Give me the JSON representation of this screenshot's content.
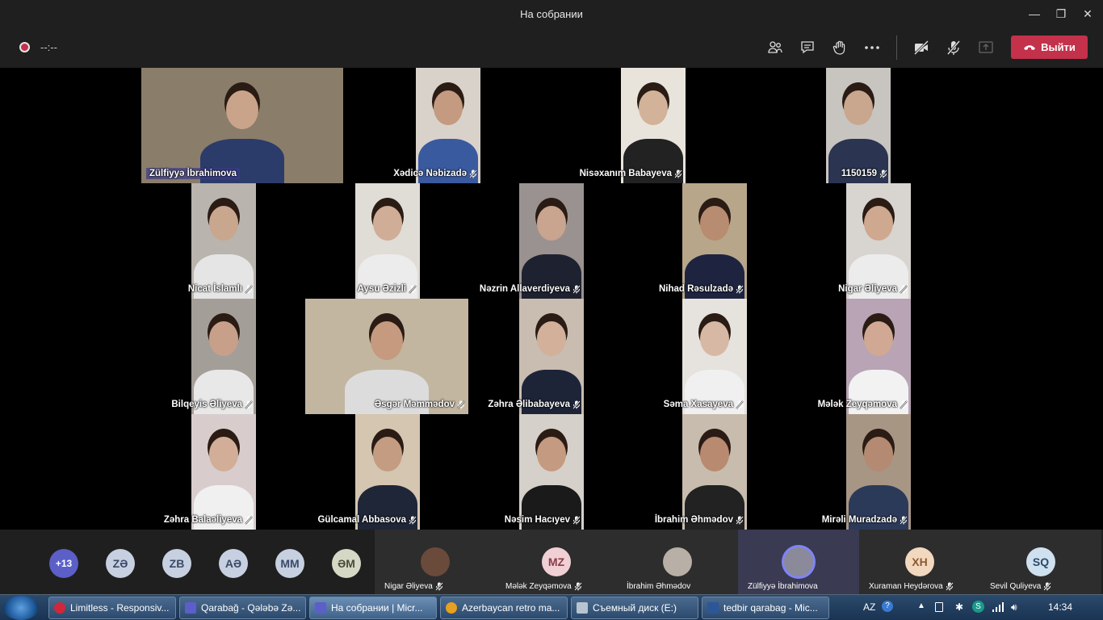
{
  "window": {
    "title": "На собрании"
  },
  "toolbar": {
    "timer": "--:--",
    "leave_label": "Выйти"
  },
  "tiles": [
    {
      "name": "Zülfiyyə İbrahimova",
      "label_style": "highlight",
      "skin": "#c9a48a",
      "bg": "#8a7d6a",
      "shirt": "#2b3b6a",
      "muted": false
    },
    {
      "name": "Xədicə Nəbizadə",
      "skin": "#c49a80",
      "bg": "#d9d2ca",
      "shirt": "#3a5aa0",
      "muted": true
    },
    {
      "name": "Nisəxanım Babayeva",
      "skin": "#d3b29a",
      "bg": "#e8e4dc",
      "shirt": "#222",
      "muted": true
    },
    {
      "name": "1150159",
      "skin": "#c9a68e",
      "bg": "#c8c4c0",
      "shirt": "#2b3450",
      "muted": true
    },
    {
      "name": "Nicat İslamlı",
      "skin": "#c9a68e",
      "bg": "#b9b4ad",
      "shirt": "#e5e5e5",
      "muted": true
    },
    {
      "name": "Aysu Əzizli",
      "skin": "#d0ad96",
      "bg": "#e0dcd6",
      "shirt": "#ececec",
      "muted": true
    },
    {
      "name": "Nəzrin Allaverdiyeva",
      "skin": "#c9a48e",
      "bg": "#9a9290",
      "shirt": "#1e2230",
      "muted": true
    },
    {
      "name": "Nihad Rəsulzadə",
      "skin": "#b88c70",
      "bg": "#b7a68a",
      "shirt": "#1e2440",
      "muted": true
    },
    {
      "name": "Nigar Əliyeva",
      "skin": "#cfa890",
      "bg": "#d8d4d0",
      "shirt": "#ececec",
      "muted": true
    },
    {
      "name": "Bilqeyis Əliyeva",
      "skin": "#c8a08a",
      "bg": "#a49e98",
      "shirt": "#e8e8e8",
      "muted": true
    },
    {
      "name": "Əsgər Məmmədov",
      "skin": "#c59a7e",
      "bg": "#c2b6a0",
      "shirt": "#dcdcdc",
      "muted": true
    },
    {
      "name": "Zəhra Əlibabayeva",
      "skin": "#d3b09a",
      "bg": "#c9bcb0",
      "shirt": "#1e2438",
      "muted": true
    },
    {
      "name": "Səma Xasayeva",
      "skin": "#d6b8a4",
      "bg": "#e6e2de",
      "shirt": "#f0f0f0",
      "muted": true
    },
    {
      "name": "Mələk Zeyqəmova",
      "skin": "#d0a894",
      "bg": "#b8a4b4",
      "shirt": "#f2f2f2",
      "muted": true
    },
    {
      "name": "Zəhra Balaəliyeva",
      "skin": "#d2ae98",
      "bg": "#d8cccc",
      "shirt": "#f0f0f0",
      "muted": true
    },
    {
      "name": "Gülcamal Abbasova",
      "skin": "#c49c82",
      "bg": "#d4c6b0",
      "shirt": "#1f2638",
      "muted": true
    },
    {
      "name": "Nəsim Hacıyev",
      "skin": "#c49a80",
      "bg": "#d6d0ca",
      "shirt": "#1a1a1a",
      "muted": true
    },
    {
      "name": "İbrahim Əhmədov",
      "skin": "#b88a70",
      "bg": "#c8bcae",
      "shirt": "#222",
      "muted": true
    },
    {
      "name": "Mirəli Muradzadə",
      "skin": "#b48a72",
      "bg": "#a89684",
      "shirt": "#2c3a5a",
      "muted": true
    }
  ],
  "strip": {
    "overflow_count": "+13",
    "avatars": [
      {
        "initials": "ZƏ",
        "color": "#c7d0e0",
        "text": "#3a4a6a"
      },
      {
        "initials": "ZB",
        "color": "#c7d0e0",
        "text": "#3a4a6a"
      },
      {
        "initials": "AƏ",
        "color": "#c7d0e0",
        "text": "#3a4a6a"
      },
      {
        "initials": "MM",
        "color": "#c7d0e0",
        "text": "#3a4a6a"
      },
      {
        "initials": "ƏM",
        "color": "#d6d8c6",
        "text": "#4a4c3a"
      }
    ],
    "participants": [
      {
        "name": "Nigar Əliyeva",
        "initials": "",
        "color": "#6a4a3a",
        "muted": true
      },
      {
        "name": "Mələk Zeyqəmova",
        "initials": "MZ",
        "color": "#f0d0d4",
        "text": "#8a3a4a",
        "muted": true
      },
      {
        "name": "İbrahim Əhmədov",
        "initials": "",
        "color": "#b8b0a6",
        "muted": false
      },
      {
        "name": "Zülfiyyə İbrahimova",
        "initials": "",
        "color": "#8a8a9a",
        "muted": false
      },
      {
        "name": "Xuraman Heydərova",
        "initials": "XH",
        "color": "#f3d8c0",
        "text": "#8a5a30",
        "muted": true
      },
      {
        "name": "Sevil Quliyeva",
        "initials": "SQ",
        "color": "#cfe0ee",
        "text": "#2a4a6a",
        "muted": true
      }
    ]
  },
  "taskbar": {
    "tasks": [
      {
        "label": "Limitless - Responsiv...",
        "icon": "opera-icon",
        "color": "#d0283a"
      },
      {
        "label": "Qarabağ - Qələbə Zə...",
        "icon": "teams-icon",
        "color": "#5b5fc7"
      },
      {
        "label": "На собрании | Micr...",
        "icon": "teams-icon",
        "color": "#5b5fc7",
        "active": true
      },
      {
        "label": "Azerbaycan retro ma...",
        "icon": "chrome-icon",
        "color": "#e8a020"
      },
      {
        "label": "Съемный диск (E:)",
        "icon": "drive-icon",
        "color": "#b8c4d0"
      },
      {
        "label": "tedbir qarabag - Mic...",
        "icon": "word-icon",
        "color": "#2b5797"
      }
    ],
    "language": "AZ",
    "time": "14:34"
  }
}
